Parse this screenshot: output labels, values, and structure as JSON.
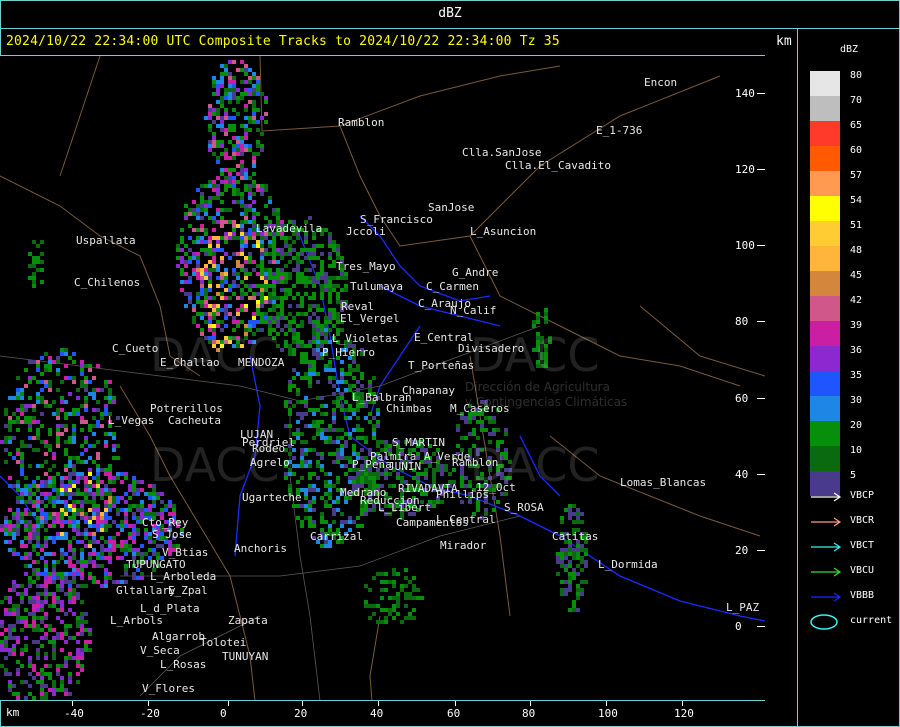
{
  "window": {
    "title": "dBZ"
  },
  "header": {
    "headline": "2024/10/22 22:34:00 UTC Composite Tracks to 2024/10/22 22:34:00 Tz 35",
    "km_label": "km"
  },
  "axes": {
    "x_unit": "km",
    "y_ticks": [
      "140",
      "120",
      "100",
      "80",
      "60",
      "40",
      "20",
      "0"
    ],
    "x_ticks": [
      "-40",
      "-20",
      "0",
      "20",
      "40",
      "60",
      "80",
      "100",
      "120"
    ]
  },
  "legend": {
    "title": "dBZ",
    "levels": [
      {
        "value": "80",
        "color": "#e6e6e6"
      },
      {
        "value": "70",
        "color": "#bebebe"
      },
      {
        "value": "65",
        "color": "#ff3a2a"
      },
      {
        "value": "60",
        "color": "#ff5a00"
      },
      {
        "value": "57",
        "color": "#ff9a50"
      },
      {
        "value": "54",
        "color": "#ffff00"
      },
      {
        "value": "51",
        "color": "#ffcc33"
      },
      {
        "value": "48",
        "color": "#ffb43a"
      },
      {
        "value": "45",
        "color": "#d2873c"
      },
      {
        "value": "42",
        "color": "#d0578a"
      },
      {
        "value": "39",
        "color": "#cc1ea3"
      },
      {
        "value": "36",
        "color": "#8d27cf"
      },
      {
        "value": "35",
        "color": "#1e55ff"
      },
      {
        "value": "30",
        "color": "#1e87e6"
      },
      {
        "value": "20",
        "color": "#078f0c"
      },
      {
        "value": "10",
        "color": "#0a6a10"
      },
      {
        "value": "5",
        "color": "#4a3a8c"
      }
    ],
    "tracks": [
      {
        "name": "VBCP",
        "color": "#ffffff"
      },
      {
        "name": "VBCR",
        "color": "#ff9a7a"
      },
      {
        "name": "VBCT",
        "color": "#3af0f0"
      },
      {
        "name": "VBCU",
        "color": "#2ee02e"
      },
      {
        "name": "VBBB",
        "color": "#1a2bff"
      },
      {
        "name": "current",
        "color": "#3af0f0"
      }
    ]
  },
  "places": [
    {
      "name": "Ramblon",
      "key": "p1"
    },
    {
      "name": "Encon",
      "key": "p2"
    },
    {
      "name": "E_1-736",
      "key": "p3"
    },
    {
      "name": "Clla.SanJose",
      "key": "p4"
    },
    {
      "name": "Clla.El_Cavadito",
      "key": "p5"
    },
    {
      "name": "SanJose",
      "key": "p6"
    },
    {
      "name": "S_Francisco",
      "key": "p7"
    },
    {
      "name": "Jccoli",
      "key": "p8"
    },
    {
      "name": "L_Asuncion",
      "key": "p9"
    },
    {
      "name": "Uspallata",
      "key": "p10"
    },
    {
      "name": "Tres_Mayo",
      "key": "p11"
    },
    {
      "name": "G_Andre",
      "key": "p12"
    },
    {
      "name": "C_Carmen",
      "key": "p13"
    },
    {
      "name": "Tulumaya",
      "key": "p14"
    },
    {
      "name": "C_Chilenos",
      "key": "p15"
    },
    {
      "name": "C_Araujo",
      "key": "p16"
    },
    {
      "name": "N_Calif",
      "key": "p17"
    },
    {
      "name": "El_Vergel",
      "key": "p18"
    },
    {
      "name": "Reval",
      "key": "p19"
    },
    {
      "name": "L_Violetas",
      "key": "p20"
    },
    {
      "name": "E_Central",
      "key": "p21"
    },
    {
      "name": "Divisadero",
      "key": "p22"
    },
    {
      "name": "C_Cueto",
      "key": "p23"
    },
    {
      "name": "P_Hierro",
      "key": "p24"
    },
    {
      "name": "T_Porteñas",
      "key": "p25"
    },
    {
      "name": "Chapanay",
      "key": "p26"
    },
    {
      "name": "L_Balbran",
      "key": "p27"
    },
    {
      "name": "Chimbas",
      "key": "p28"
    },
    {
      "name": "M_Caseros",
      "key": "p29"
    },
    {
      "name": "Potrerillos",
      "key": "p30"
    },
    {
      "name": "L_Vegas",
      "key": "p31"
    },
    {
      "name": "Cacheuta",
      "key": "p32"
    },
    {
      "name": "Perdriel",
      "key": "p33"
    },
    {
      "name": "S_MARTIN",
      "key": "p34"
    },
    {
      "name": "Palmira",
      "key": "p35"
    },
    {
      "name": "A_Verde",
      "key": "p36"
    },
    {
      "name": "Ramblon",
      "key": "p37"
    },
    {
      "name": "Agrelo",
      "key": "p38"
    },
    {
      "name": "Lomas_Blancas",
      "key": "p39"
    },
    {
      "name": "12_Oct",
      "key": "p40"
    },
    {
      "name": "Medrano",
      "key": "p41"
    },
    {
      "name": "Phillips",
      "key": "p42"
    },
    {
      "name": "Ugarteche",
      "key": "p43"
    },
    {
      "name": "S_ROSA",
      "key": "p44"
    },
    {
      "name": "Cto_Rey",
      "key": "p45"
    },
    {
      "name": "L_Libert",
      "key": "p46"
    },
    {
      "name": "L_Central",
      "key": "p47"
    },
    {
      "name": "Campamentos",
      "key": "p48"
    },
    {
      "name": "Catitas",
      "key": "p49"
    },
    {
      "name": "S_Jose",
      "key": "p50"
    },
    {
      "name": "Carrizal",
      "key": "p51"
    },
    {
      "name": "Mirador",
      "key": "p52"
    },
    {
      "name": "V_Btias",
      "key": "p53"
    },
    {
      "name": "Anchoris",
      "key": "p54"
    },
    {
      "name": "TUPUNGATO",
      "key": "p55"
    },
    {
      "name": "L_Dormida",
      "key": "p56"
    },
    {
      "name": "L_Arboleda",
      "key": "p57"
    },
    {
      "name": "Gltallary",
      "key": "p58"
    },
    {
      "name": "E_Zpal",
      "key": "p59"
    },
    {
      "name": "L_PAZ",
      "key": "p60"
    },
    {
      "name": "L_d_Plata",
      "key": "p61"
    },
    {
      "name": "L_Arbols",
      "key": "p62"
    },
    {
      "name": "Zapata",
      "key": "p63"
    },
    {
      "name": "Algarrob",
      "key": "p64"
    },
    {
      "name": "V_Seca",
      "key": "p65"
    },
    {
      "name": "Tolotei",
      "key": "p66"
    },
    {
      "name": "L_Rosas",
      "key": "p67"
    },
    {
      "name": "TUNUYAN",
      "key": "p68"
    },
    {
      "name": "V_Flores",
      "key": "p69"
    },
    {
      "name": "Lavadevila",
      "key": "p70"
    },
    {
      "name": "E_Challao",
      "key": "p71"
    },
    {
      "name": "MENDOZA",
      "key": "p72"
    },
    {
      "name": "LUJAN",
      "key": "p73"
    },
    {
      "name": "Rodeo",
      "key": "p74"
    },
    {
      "name": "Reduccion",
      "key": "p75"
    },
    {
      "name": "JUNIN",
      "key": "p76"
    },
    {
      "name": "RIVADAVIA",
      "key": "p77"
    },
    {
      "name": "P_Peña",
      "key": "p78"
    }
  ],
  "watermarks": [
    {
      "text": "DACC",
      "key": "w1"
    },
    {
      "text": "DACC",
      "key": "w2"
    },
    {
      "text": "DACC",
      "key": "w3"
    },
    {
      "text": "DACC",
      "key": "w4"
    },
    {
      "text": "Dirección de Agricultura",
      "key": "w5"
    },
    {
      "text": "y Contingencias Climáticas",
      "key": "w6"
    }
  ]
}
